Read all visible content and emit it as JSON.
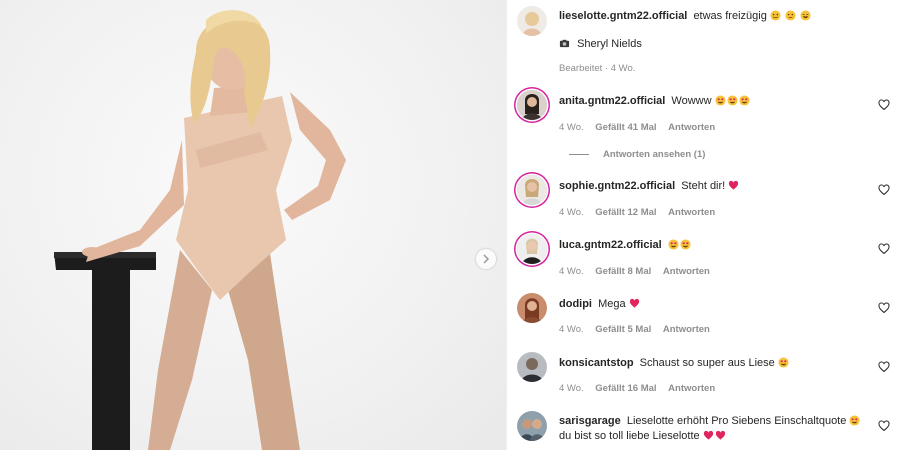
{
  "post": {
    "author": "lieselotte.gntm22.official",
    "caption": "etwas freizügig",
    "credit": "Sheryl Nields",
    "edited": "Bearbeitet · 4 Wo."
  },
  "comments": [
    {
      "user": "anita.gntm22.official",
      "text": "Wowww",
      "time": "4 Wo.",
      "likes": "Gefällt 41 Mal",
      "reply": "Antworten",
      "view_replies": "Antworten ansehen (1)"
    },
    {
      "user": "sophie.gntm22.official",
      "text": "Steht dir!",
      "time": "4 Wo.",
      "likes": "Gefällt 12 Mal",
      "reply": "Antworten"
    },
    {
      "user": "luca.gntm22.official",
      "text": "",
      "time": "4 Wo.",
      "likes": "Gefällt 8 Mal",
      "reply": "Antworten"
    },
    {
      "user": "dodipi",
      "text": "Mega",
      "time": "4 Wo.",
      "likes": "Gefällt 5 Mal",
      "reply": "Antworten"
    },
    {
      "user": "konsicantstop",
      "text": "Schaust so super aus Liese",
      "time": "4 Wo.",
      "likes": "Gefällt 16 Mal",
      "reply": "Antworten"
    },
    {
      "user": "sarisgarage",
      "text": "Lieselotte erhöht Pro Siebens Einschaltquote",
      "text2": "du bist so toll liebe Lieselotte"
    }
  ],
  "icons": {
    "like": "heart-outline-icon",
    "next": "chevron-right-icon",
    "camera": "camera-icon"
  },
  "colors": {
    "text": "#262626",
    "secondary": "#8e8e8e",
    "story_ring": "#d6249f",
    "heart_emoji": "#e0245e"
  }
}
